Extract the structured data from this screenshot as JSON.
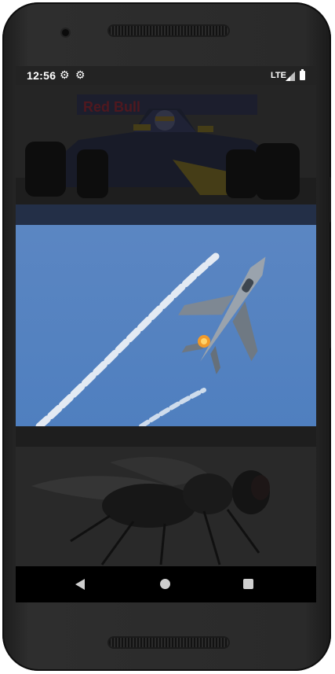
{
  "status_bar": {
    "time": "12:56",
    "network": "LTE",
    "icons": [
      "gear-icon",
      "gear-icon",
      "signal-icon",
      "battery-icon"
    ]
  },
  "feed": {
    "items": [
      {
        "subject": "red-bull-f1-car-image",
        "state": "dimmed"
      },
      {
        "subject": "fighter-jet-image",
        "state": "highlighted"
      },
      {
        "subject": "housefly-image",
        "state": "dimmed"
      }
    ]
  },
  "nav_bar": {
    "icons": [
      "back-icon",
      "home-icon",
      "recents-icon"
    ]
  },
  "colors": {
    "screen_bg": "#2a2a2a",
    "status_bar_bg": "#232323",
    "nav_bar_bg": "#000000",
    "sky_blue": "#5a85bf"
  }
}
